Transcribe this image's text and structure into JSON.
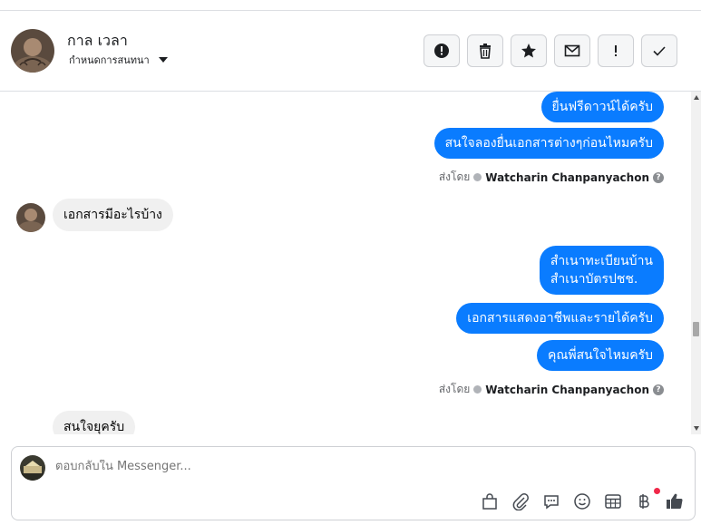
{
  "contact": {
    "name": "กาล เวลา",
    "subtitle": "กำหนดการสนทนา"
  },
  "header_actions": [
    {
      "icon": "alert-circle-icon"
    },
    {
      "icon": "trash-icon"
    },
    {
      "icon": "star-icon"
    },
    {
      "icon": "envelope-icon"
    },
    {
      "icon": "exclamation-icon"
    },
    {
      "icon": "checkmark-icon"
    }
  ],
  "messages": {
    "out1": "ยื่นฟรีดาวน์ได้ครับ",
    "out2": "สนใจลองยื่นเอกสารต่างๆก่อนไหมครับ",
    "in1": "เอกสารมีอะไรบ้าง",
    "out3": "สำเนาทะเบียนบ้าน\nสำเนาบัตรปชช.",
    "out4": "เอกสารแสดงอาชีพและรายได้ครับ",
    "out5": "คุณพี่สนใจไหมครับ",
    "in2": "สนใจยุครับ"
  },
  "sent_by": {
    "label": "ส่งโดย",
    "sender": "Watcharin Chanpanyachon",
    "help": "?"
  },
  "composer": {
    "placeholder": "ตอบกลับใน Messenger...",
    "tools": [
      "shopping-bag-icon",
      "paperclip-icon",
      "chat-bubble-icon",
      "smiley-icon",
      "table-icon",
      "baht-icon",
      "thumbs-up-icon"
    ]
  },
  "colors": {
    "bubble_out": "#0a7cff",
    "bubble_in": "#f0f0f0",
    "notification": "#f02849"
  }
}
